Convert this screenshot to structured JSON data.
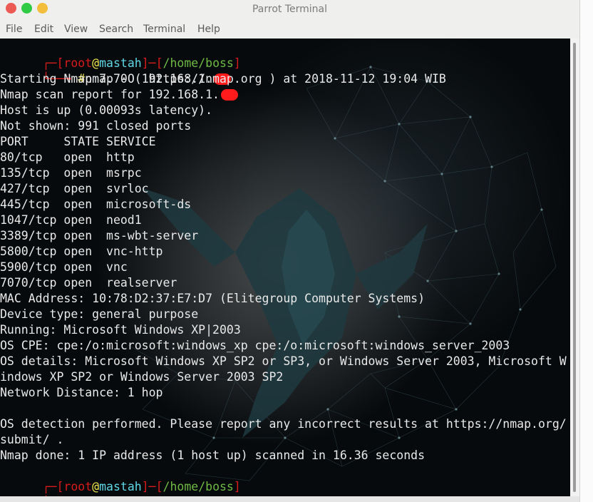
{
  "window": {
    "title": "Parrot Terminal",
    "menu": [
      "File",
      "Edit",
      "View",
      "Search",
      "Terminal",
      "Help"
    ]
  },
  "colors": {
    "prompt_frame": "#d81b1b",
    "user": "#d81b1b",
    "host": "#5fd7e6",
    "path": "#6fba44",
    "hash": "#f2e64c",
    "redaction": "#ff1b1b",
    "text": "#e9e9e9"
  },
  "prompt1": {
    "frame_open": "┌─[",
    "user": "root",
    "at": "@",
    "host": "mastah",
    "sep": "]─[",
    "path": "/home/boss",
    "frame_close": "]",
    "corner": "└──╼ ",
    "hash": "#",
    "command": "nmap -O 192.168.1."
  },
  "output": {
    "starting": "Starting Nmap 7.70 ( https://nmap.org ) at 2018-11-12 19:04 WIB",
    "report": "Nmap scan report for 192.168.1.",
    "host_up": "Host is up (0.00093s latency).",
    "not_shown": "Not shown: 991 closed ports",
    "header": "PORT     STATE SERVICE",
    "ports": [
      "80/tcp   open  http",
      "135/tcp  open  msrpc",
      "427/tcp  open  svrloc",
      "445/tcp  open  microsoft-ds",
      "1047/tcp open  neod1",
      "3389/tcp open  ms-wbt-server",
      "5800/tcp open  vnc-http",
      "5900/tcp open  vnc",
      "7070/tcp open  realserver"
    ],
    "mac": "MAC Address: 10:78:D2:37:E7:D7 (Elitegroup Computer Systems)",
    "device_type": "Device type: general purpose",
    "running": "Running: Microsoft Windows XP|2003",
    "os_cpe": "OS CPE: cpe:/o:microsoft:windows_xp cpe:/o:microsoft:windows_server_2003",
    "os_details_1": "OS details: Microsoft Windows XP SP2 or SP3, or Windows Server 2003, Microsoft W",
    "os_details_2": "indows XP SP2 or Windows Server 2003 SP2",
    "network_distance": "Network Distance: 1 hop",
    "detection_1": "OS detection performed. Please report any incorrect results at https://nmap.org/",
    "detection_2": "submit/ .",
    "done": "Nmap done: 1 IP address (1 host up) scanned in 16.36 seconds"
  },
  "prompt2": {
    "frame_open": "┌─[",
    "user": "root",
    "at": "@",
    "host": "mastah",
    "sep": "]─[",
    "path": "/home/boss",
    "frame_close": "]",
    "corner": "└──╼ ",
    "hash": "#"
  }
}
